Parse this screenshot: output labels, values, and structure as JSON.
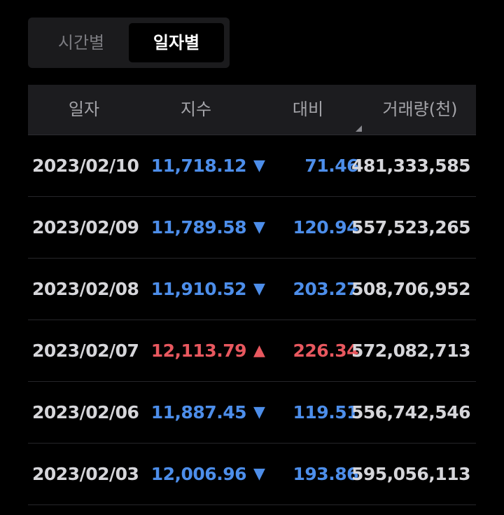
{
  "tabs": {
    "by_time": "시간별",
    "by_day": "일자별",
    "active": "by_day"
  },
  "table": {
    "headers": {
      "date": "일자",
      "index": "지수",
      "change": "대비",
      "volume": "거래량(천)"
    },
    "rows": [
      {
        "date": "2023/02/10",
        "index": "11,718.12",
        "direction": "down",
        "arrow": "▼",
        "change": "71.46",
        "volume": "481,333,585"
      },
      {
        "date": "2023/02/09",
        "index": "11,789.58",
        "direction": "down",
        "arrow": "▼",
        "change": "120.94",
        "volume": "557,523,265"
      },
      {
        "date": "2023/02/08",
        "index": "11,910.52",
        "direction": "down",
        "arrow": "▼",
        "change": "203.27",
        "volume": "508,706,952"
      },
      {
        "date": "2023/02/07",
        "index": "12,113.79",
        "direction": "up",
        "arrow": "▲",
        "change": "226.34",
        "volume": "572,082,713"
      },
      {
        "date": "2023/02/06",
        "index": "11,887.45",
        "direction": "down",
        "arrow": "▼",
        "change": "119.51",
        "volume": "556,742,546"
      },
      {
        "date": "2023/02/03",
        "index": "12,006.96",
        "direction": "down",
        "arrow": "▼",
        "change": "193.86",
        "volume": "595,056,113"
      }
    ]
  },
  "colors": {
    "down": "#4d8eea",
    "up": "#e8585f",
    "background": "#000000"
  }
}
